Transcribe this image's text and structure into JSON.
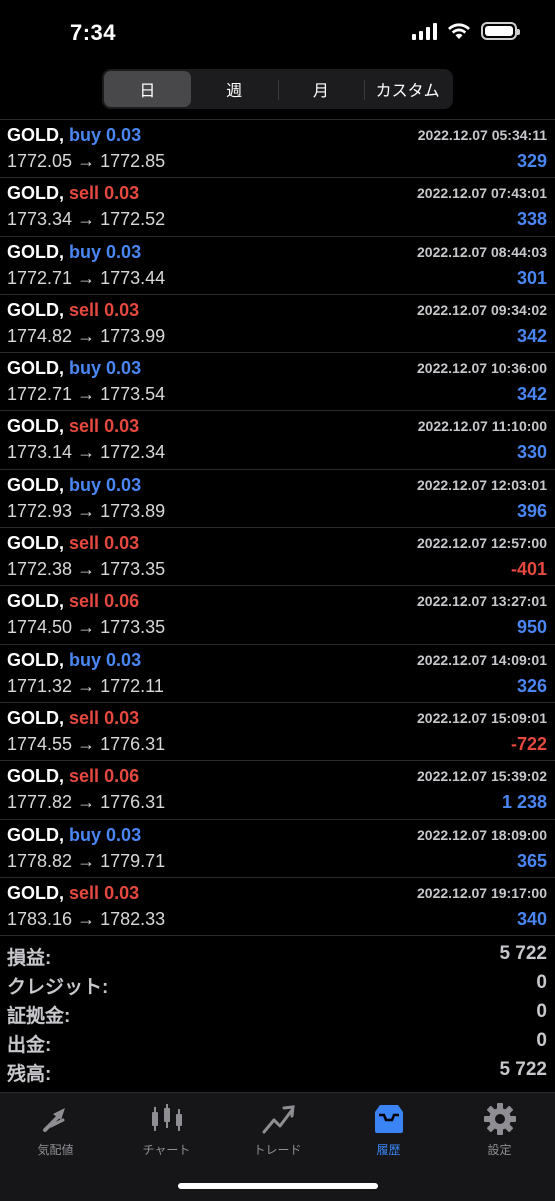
{
  "status": {
    "time": "7:34"
  },
  "tabs_filter": {
    "day": "日",
    "week": "週",
    "month": "月",
    "custom": "カスタム"
  },
  "deals": [
    {
      "symbol": "GOLD,",
      "side": "buy",
      "volume": "0.03",
      "time": "2022.12.07 05:34:11",
      "open": "1772.05",
      "close": "1772.85",
      "profit": "329",
      "profit_sign": "pos"
    },
    {
      "symbol": "GOLD,",
      "side": "sell",
      "volume": "0.03",
      "time": "2022.12.07 07:43:01",
      "open": "1773.34",
      "close": "1772.52",
      "profit": "338",
      "profit_sign": "pos"
    },
    {
      "symbol": "GOLD,",
      "side": "buy",
      "volume": "0.03",
      "time": "2022.12.07 08:44:03",
      "open": "1772.71",
      "close": "1773.44",
      "profit": "301",
      "profit_sign": "pos"
    },
    {
      "symbol": "GOLD,",
      "side": "sell",
      "volume": "0.03",
      "time": "2022.12.07 09:34:02",
      "open": "1774.82",
      "close": "1773.99",
      "profit": "342",
      "profit_sign": "pos"
    },
    {
      "symbol": "GOLD,",
      "side": "buy",
      "volume": "0.03",
      "time": "2022.12.07 10:36:00",
      "open": "1772.71",
      "close": "1773.54",
      "profit": "342",
      "profit_sign": "pos"
    },
    {
      "symbol": "GOLD,",
      "side": "sell",
      "volume": "0.03",
      "time": "2022.12.07 11:10:00",
      "open": "1773.14",
      "close": "1772.34",
      "profit": "330",
      "profit_sign": "pos"
    },
    {
      "symbol": "GOLD,",
      "side": "buy",
      "volume": "0.03",
      "time": "2022.12.07 12:03:01",
      "open": "1772.93",
      "close": "1773.89",
      "profit": "396",
      "profit_sign": "pos"
    },
    {
      "symbol": "GOLD,",
      "side": "sell",
      "volume": "0.03",
      "time": "2022.12.07 12:57:00",
      "open": "1772.38",
      "close": "1773.35",
      "profit": "-401",
      "profit_sign": "neg"
    },
    {
      "symbol": "GOLD,",
      "side": "sell",
      "volume": "0.06",
      "time": "2022.12.07 13:27:01",
      "open": "1774.50",
      "close": "1773.35",
      "profit": "950",
      "profit_sign": "pos"
    },
    {
      "symbol": "GOLD,",
      "side": "buy",
      "volume": "0.03",
      "time": "2022.12.07 14:09:01",
      "open": "1771.32",
      "close": "1772.11",
      "profit": "326",
      "profit_sign": "pos"
    },
    {
      "symbol": "GOLD,",
      "side": "sell",
      "volume": "0.03",
      "time": "2022.12.07 15:09:01",
      "open": "1774.55",
      "close": "1776.31",
      "profit": "-722",
      "profit_sign": "neg"
    },
    {
      "symbol": "GOLD,",
      "side": "sell",
      "volume": "0.06",
      "time": "2022.12.07 15:39:02",
      "open": "1777.82",
      "close": "1776.31",
      "profit": "1 238",
      "profit_sign": "pos"
    },
    {
      "symbol": "GOLD,",
      "side": "buy",
      "volume": "0.03",
      "time": "2022.12.07 18:09:00",
      "open": "1778.82",
      "close": "1779.71",
      "profit": "365",
      "profit_sign": "pos"
    },
    {
      "symbol": "GOLD,",
      "side": "sell",
      "volume": "0.03",
      "time": "2022.12.07 19:17:00",
      "open": "1783.16",
      "close": "1782.33",
      "profit": "340",
      "profit_sign": "pos"
    }
  ],
  "arrow": "→",
  "summary": [
    {
      "label": "損益:",
      "value": "5 722"
    },
    {
      "label": "クレジット:",
      "value": "0"
    },
    {
      "label": "証拠金:",
      "value": "0"
    },
    {
      "label": "出金:",
      "value": "0"
    },
    {
      "label": "残高:",
      "value": "5 722"
    }
  ],
  "tabbar": [
    {
      "label": "気配値",
      "icon": "quotes-icon"
    },
    {
      "label": "チャート",
      "icon": "chart-icon"
    },
    {
      "label": "トレード",
      "icon": "trade-icon"
    },
    {
      "label": "履歴",
      "icon": "history-icon",
      "active": true
    },
    {
      "label": "設定",
      "icon": "settings-icon"
    }
  ],
  "colors": {
    "buy": "#4a86f2",
    "sell": "#e5483e",
    "active_tab": "#3a84f5"
  }
}
